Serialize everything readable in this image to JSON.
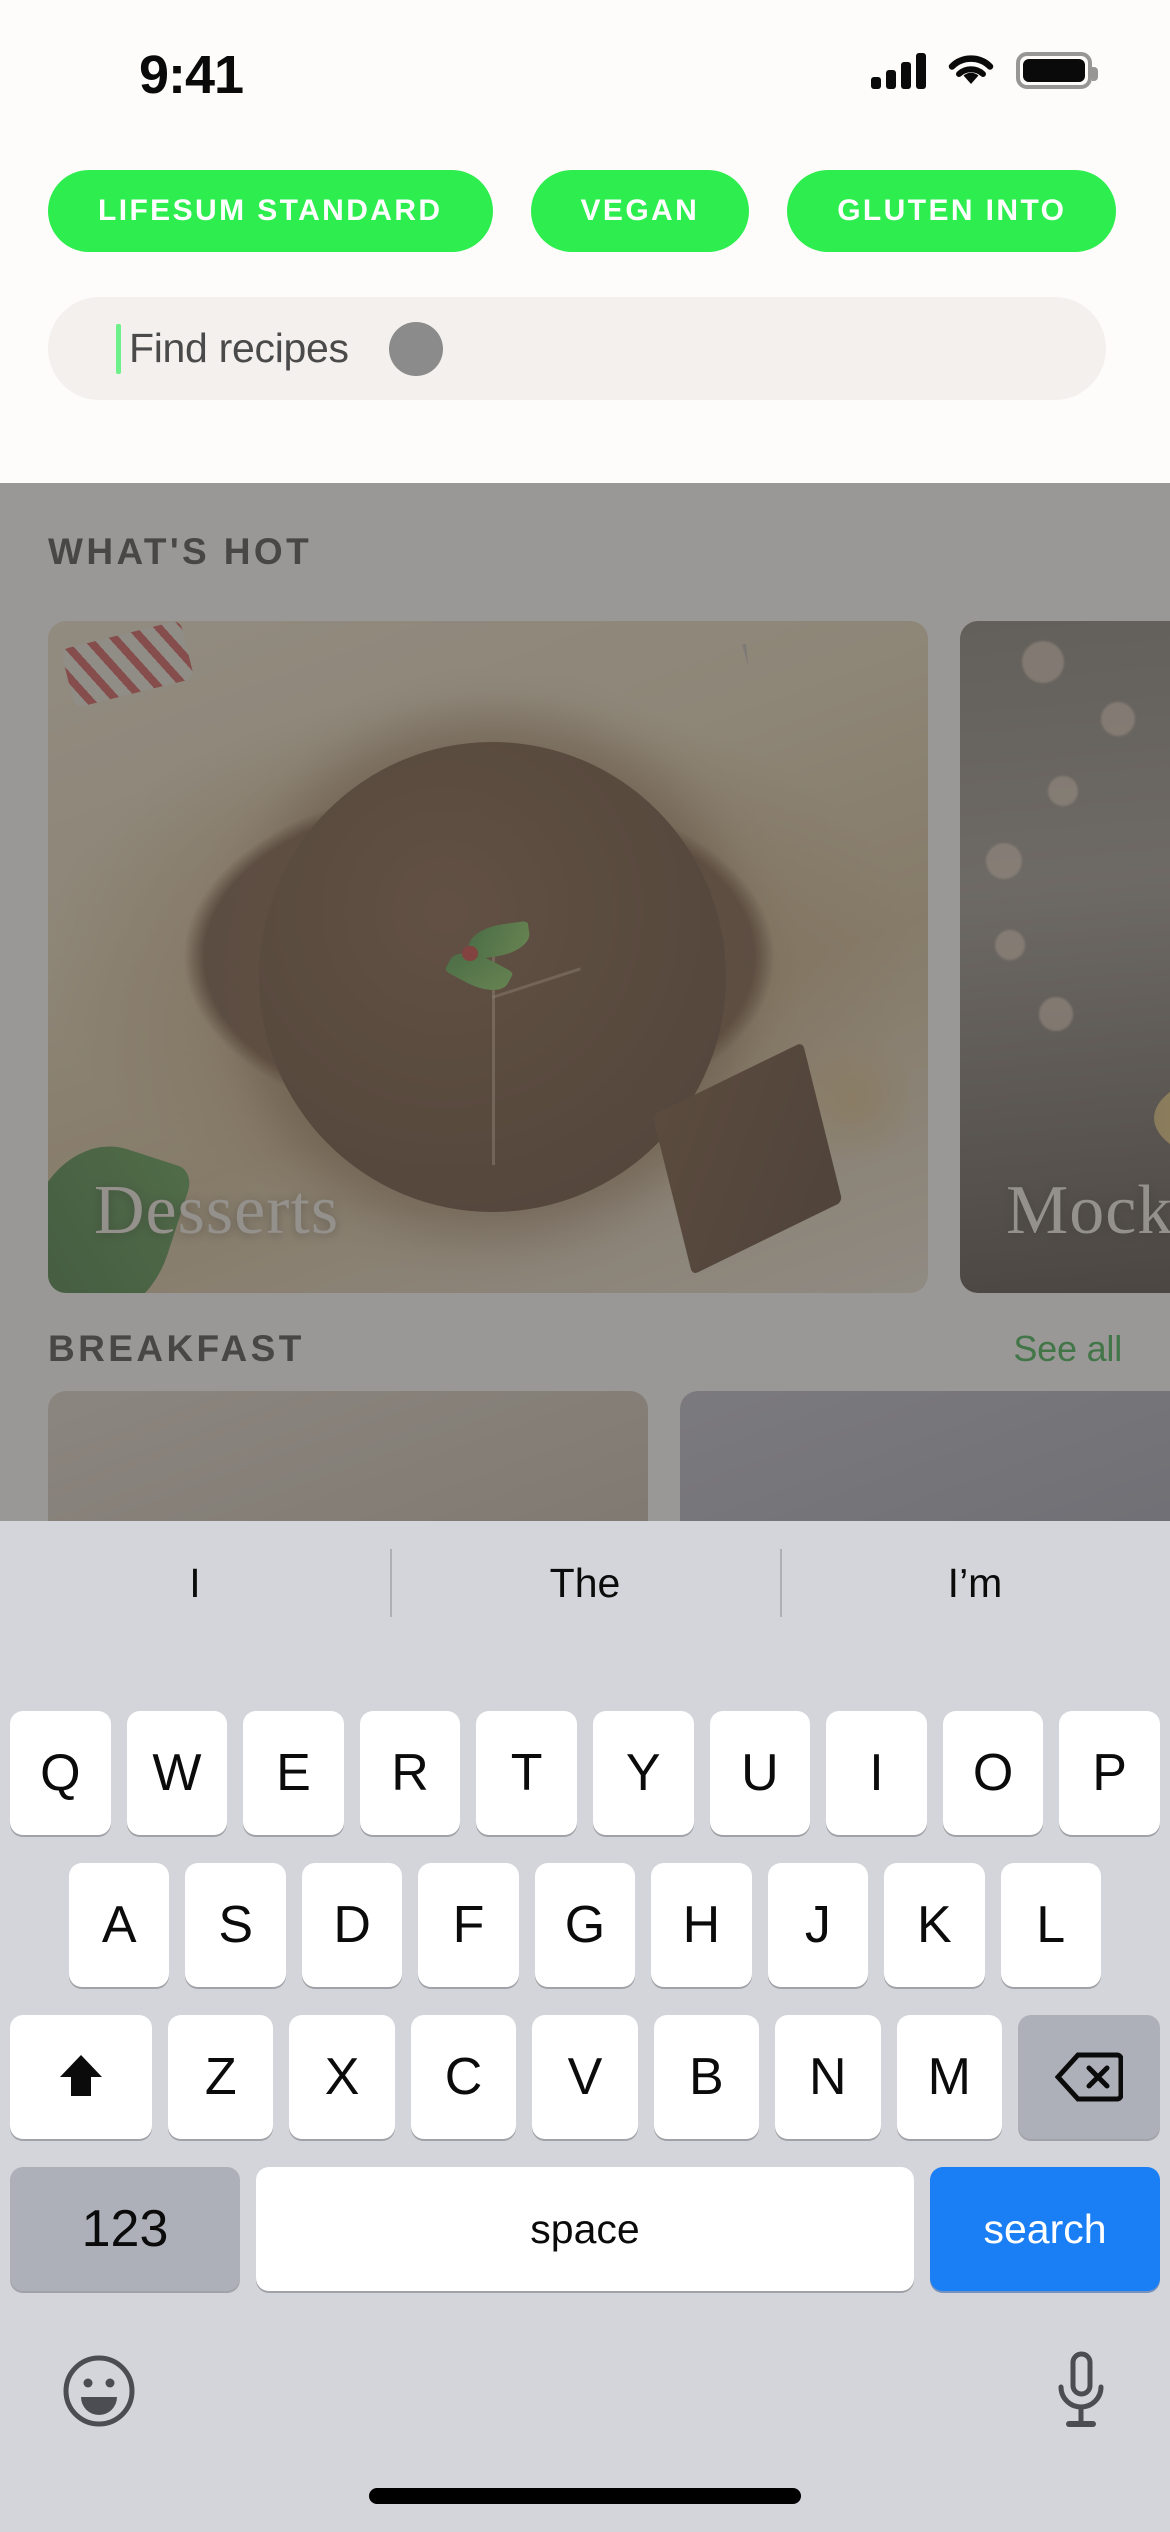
{
  "status_bar": {
    "time": "9:41",
    "cellular_icon": "cellular-signal-icon",
    "wifi_icon": "wifi-icon",
    "battery_icon": "battery-full-icon"
  },
  "filters": {
    "chips": [
      {
        "label": "LIFESUM STANDARD",
        "active": true
      },
      {
        "label": "VEGAN",
        "active": true
      },
      {
        "label": "GLUTEN INTO",
        "active": true
      }
    ],
    "accent_color": "#2ded4f"
  },
  "search": {
    "placeholder": "Find recipes",
    "value": "",
    "cursor_color": "#6ef08a",
    "field_background": "#f3f0ed",
    "indicator_icon": "loading-dot-icon"
  },
  "content": {
    "whats_hot": {
      "title": "WHAT'S HOT",
      "cards": [
        {
          "label": "Desserts",
          "image": "chocolate-cake-with-holly"
        },
        {
          "label": "Mock",
          "image": "mocktail-citrus-pomegranate"
        }
      ]
    },
    "breakfast": {
      "title": "BREAKFAST",
      "see_all_label": "See all",
      "see_all_color": "#18a330",
      "cards": [
        {
          "image": "breakfast-thumb-1"
        },
        {
          "image": "breakfast-thumb-2"
        },
        {
          "image": "breakfast-thumb-3"
        }
      ]
    }
  },
  "keyboard": {
    "suggestions": [
      "I",
      "The",
      "I’m"
    ],
    "row1": [
      "Q",
      "W",
      "E",
      "R",
      "T",
      "Y",
      "U",
      "I",
      "O",
      "P"
    ],
    "row2": [
      "A",
      "S",
      "D",
      "F",
      "G",
      "H",
      "J",
      "K",
      "L"
    ],
    "row3_letters": [
      "Z",
      "X",
      "C",
      "V",
      "B",
      "N",
      "M"
    ],
    "shift_icon": "shift-arrow-icon",
    "backspace_icon": "backspace-icon",
    "numbers_key": "123",
    "space_key": "space",
    "return_key": "search",
    "return_key_color": "#1a7ef5",
    "emoji_icon": "emoji-smiley-icon",
    "dictation_icon": "microphone-icon"
  }
}
